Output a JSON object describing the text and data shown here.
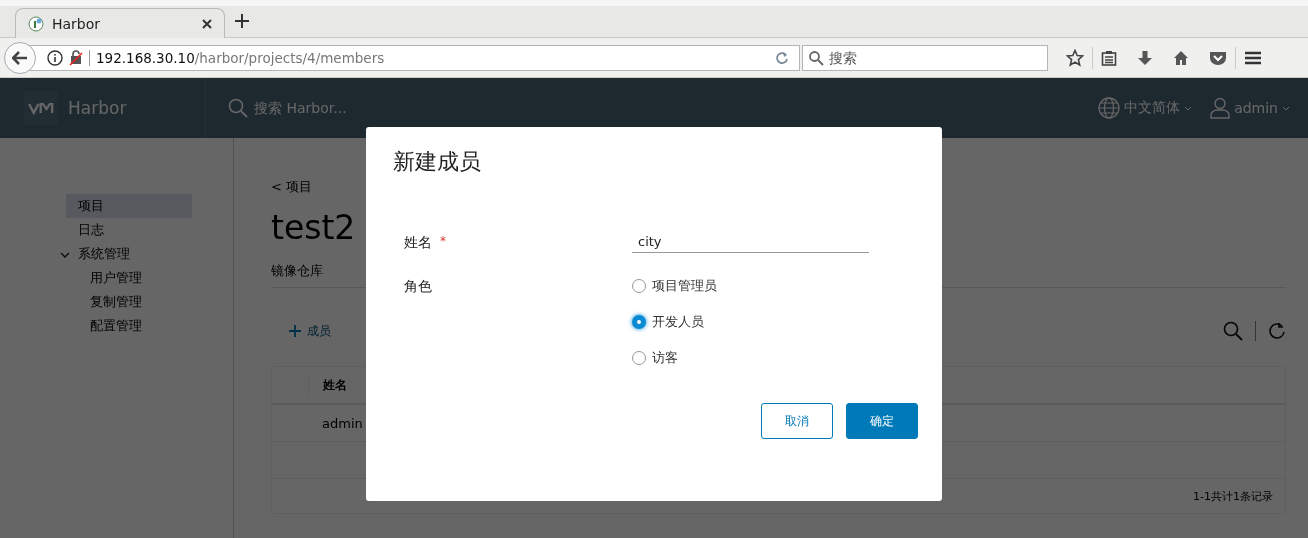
{
  "browser": {
    "tab": {
      "title": "Harbor"
    },
    "url": {
      "host": "192.168.30.10",
      "path": "/harbor/projects/4/members"
    },
    "search": {
      "placeholder": "搜索"
    }
  },
  "app": {
    "brand": "Harbor",
    "search": {
      "placeholder": "搜索 Harbor..."
    },
    "language": "中文简体",
    "user": "admin"
  },
  "sidebar": {
    "items": [
      {
        "label": "项目",
        "selected": true
      },
      {
        "label": "日志",
        "selected": false
      },
      {
        "label": "系统管理",
        "selected": false,
        "expanded": true,
        "children": [
          {
            "label": "用户管理",
            "selected": false
          },
          {
            "label": "复制管理",
            "selected": false
          },
          {
            "label": "配置管理",
            "selected": false
          }
        ]
      }
    ]
  },
  "project": {
    "back": "< 项目",
    "name": "test2",
    "tabs": [
      {
        "label": "镜像仓库",
        "selected": false
      }
    ],
    "add_button": "成员",
    "table": {
      "columns": [
        "姓名"
      ],
      "rows": [
        [
          "admin"
        ]
      ],
      "footer": "1-1共计1条记录"
    }
  },
  "dialog": {
    "title": "新建成员",
    "name_field": {
      "label": "姓名",
      "required_mark": "*",
      "value": "city"
    },
    "role": {
      "label": "角色",
      "options": [
        {
          "label": "项目管理员",
          "selected": false
        },
        {
          "label": "开发人员",
          "selected": true
        },
        {
          "label": "访客",
          "selected": false
        }
      ]
    },
    "buttons": [
      {
        "label": "取消",
        "kind": "secondary"
      },
      {
        "label": "确定",
        "kind": "primary"
      }
    ]
  }
}
